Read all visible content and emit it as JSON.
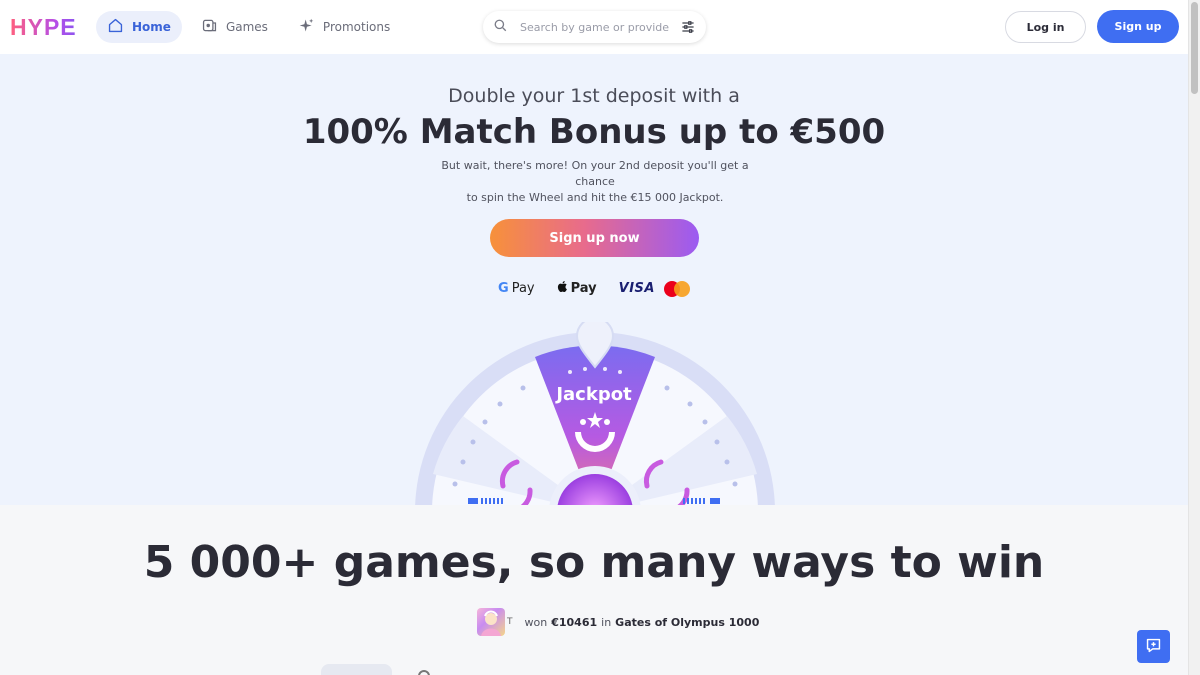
{
  "brand": {
    "logo_text": "HYPE",
    "accent": "#3f6ef2"
  },
  "nav": [
    {
      "label": "Home",
      "icon": "home-icon",
      "active": true
    },
    {
      "label": "Games",
      "icon": "games-icon",
      "active": false
    },
    {
      "label": "Promotions",
      "icon": "sparkle-icon",
      "active": false
    }
  ],
  "search": {
    "placeholder": "Search by game or provider",
    "value": ""
  },
  "auth": {
    "login_label": "Log in",
    "signup_label": "Sign up"
  },
  "hero": {
    "subtitle": "Double your 1st deposit with a",
    "title": "100% Match Bonus up to €500",
    "description_line1": "But wait, there's more! On your 2nd deposit you'll get a chance",
    "description_line2": "to spin the Wheel and hit the €15 000 Jackpot.",
    "cta_label": "Sign up now",
    "payments": {
      "gpay": "Pay",
      "applepay": "Pay",
      "visa": "VISA"
    },
    "wheel_label": "Jackpot"
  },
  "games": {
    "title": "5 000+ games, so many ways to win",
    "winner": {
      "initial": "T",
      "won_text": "won",
      "amount": "€10461",
      "in_text": "in",
      "game": "Gates of Olympus 1000"
    }
  }
}
